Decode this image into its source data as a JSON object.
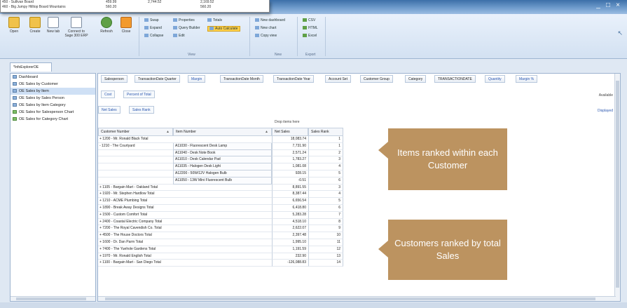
{
  "overlay": {
    "rows": [
      {
        "label": "450 - Sullivan Board",
        "v1": "459.99",
        "v2": "2,744.52",
        "v3": "2,169.52"
      },
      {
        "label": "460 - Big Jumpy Hilltop Board Mountains",
        "v1": "560.20",
        "v2": "",
        "v3": "560.20"
      }
    ]
  },
  "window": {
    "controls": [
      "_",
      "□",
      "×"
    ]
  },
  "ribbon": {
    "buttons": [
      "Open",
      "Create",
      "New tab",
      "Connect to Sage 300 ERP",
      "Refresh",
      "Close"
    ],
    "view_items": [
      {
        "label": "Swap",
        "hl": false
      },
      {
        "label": "Expand",
        "hl": false
      },
      {
        "label": "Collapse",
        "hl": false
      },
      {
        "label": "Properties",
        "hl": false
      },
      {
        "label": "Query Builder",
        "hl": false
      },
      {
        "label": "Edit",
        "hl": false
      },
      {
        "label": "Totals",
        "hl": false
      },
      {
        "label": "Auto Calculate",
        "hl": true
      }
    ],
    "view_group": "View",
    "new_items": [
      "New dashboard",
      "New chart",
      "Copy view"
    ],
    "new_group": "New",
    "export_items": [
      "CSV",
      "HTML",
      "Excel"
    ],
    "export_group": "Export"
  },
  "doc_tab": "*InfoExplorerOE",
  "tree": [
    {
      "label": "Dashboard",
      "kind": "view",
      "selected": false
    },
    {
      "label": "OE Sales by Customer",
      "kind": "view",
      "selected": false
    },
    {
      "label": "OE Sales by Item",
      "kind": "view",
      "selected": true
    },
    {
      "label": "OE Sales by Sales Person",
      "kind": "view",
      "selected": false
    },
    {
      "label": "OE Sales by Item Category",
      "kind": "view",
      "selected": false
    },
    {
      "label": "OE Sales for Salesperson Chart",
      "kind": "chart",
      "selected": false
    },
    {
      "label": "OE Sales for Category Chart",
      "kind": "chart",
      "selected": false
    }
  ],
  "fields": [
    {
      "label": "Salesperson",
      "blue": false
    },
    {
      "label": "TransactionDate Quarter",
      "blue": false
    },
    {
      "label": "Margin",
      "blue": true
    },
    {
      "label": "TransactionDate Month",
      "blue": false
    },
    {
      "label": "TransactionDate Year",
      "blue": false
    },
    {
      "label": "Account Set",
      "blue": false
    },
    {
      "label": "Customer Group",
      "blue": false
    },
    {
      "label": "Category",
      "blue": false
    },
    {
      "label": "TRANSACTIONDATE",
      "blue": false
    },
    {
      "label": "Quantity",
      "blue": true
    },
    {
      "label": "Margin %",
      "blue": true
    }
  ],
  "measures_row1": [
    "Cost",
    "Percent of Total"
  ],
  "measures_row2": [
    "Net Sales",
    "Sales Rank"
  ],
  "available": "Available",
  "displayed": "Displayed",
  "drop_here": "Drop items here",
  "columns": {
    "customer": "Customer Number",
    "item": "Item Number",
    "net_sales": "Net Sales",
    "sales_rank": "Sales Rank"
  },
  "rows": [
    {
      "cust": "+ 1200 - Mr. Ronald Black Total",
      "item": "",
      "net": "18,083.74",
      "rank": "1",
      "boxed": false
    },
    {
      "cust": "- 1210 - The Courtyard",
      "item": "A11030 - Fluorescent Desk Lamp",
      "net": "7,731.90",
      "rank": "1",
      "boxed": true
    },
    {
      "cust": "",
      "item": "A11040 - Desk Note Book",
      "net": "2,571.24",
      "rank": "2",
      "boxed": true
    },
    {
      "cust": "",
      "item": "A11010 - Desk Calendar Pad",
      "net": "1,783.27",
      "rank": "3",
      "boxed": true
    },
    {
      "cust": "",
      "item": "A11035 - Halogen Desk Light",
      "net": "1,081.08",
      "rank": "4",
      "boxed": true
    },
    {
      "cust": "",
      "item": "A12200 - 50W/12V Halogen Bulb",
      "net": "928.15",
      "rank": "5",
      "boxed": true
    },
    {
      "cust": "",
      "item": "A11050 - 13W Mini Fluorescent Bulb",
      "net": "-0.51",
      "rank": "6",
      "boxed": true
    },
    {
      "cust": "+ 1105 - Bargain Mart - Oakland Total",
      "item": "",
      "net": "8,891.55",
      "rank": "3",
      "boxed": false
    },
    {
      "cust": "+ 1920 - Mr. Stephen Hardlow Total",
      "item": "",
      "net": "8,387.44",
      "rank": "4",
      "boxed": false
    },
    {
      "cust": "+ 1210 - ACME Plumbing Total",
      "item": "",
      "net": "6,656.54",
      "rank": "5",
      "boxed": false
    },
    {
      "cust": "+ 1890 - Break Away Designs Total",
      "item": "",
      "net": "6,418.80",
      "rank": "6",
      "boxed": false
    },
    {
      "cust": "+ 1500 - Custom Comfort Total",
      "item": "",
      "net": "5,283.28",
      "rank": "7",
      "boxed": false
    },
    {
      "cust": "+ 2400 - Coastal Electric Company Total",
      "item": "",
      "net": "4,518.10",
      "rank": "8",
      "boxed": false
    },
    {
      "cust": "+ 7200 - The Royal Cavendish Co. Total",
      "item": "",
      "net": "2,622.07",
      "rank": "9",
      "boxed": false
    },
    {
      "cust": "+ 4500 - The House Doctors Total",
      "item": "",
      "net": "2,397.48",
      "rank": "10",
      "boxed": false
    },
    {
      "cust": "+ 1600 - Dr. Dan Parm Total",
      "item": "",
      "net": "1,995.10",
      "rank": "11",
      "boxed": false
    },
    {
      "cust": "+ 7400 - The Yuehole Gardens Total",
      "item": "",
      "net": "1,191.59",
      "rank": "12",
      "boxed": false
    },
    {
      "cust": "+ 1970 - Mr. Ronald English Total",
      "item": "",
      "net": "232.90",
      "rank": "13",
      "boxed": false
    },
    {
      "cust": "+ 1100 - Bargain Mart - San Diego Total",
      "item": "",
      "net": "-126,088.83",
      "rank": "14",
      "boxed": false
    }
  ],
  "callouts": [
    {
      "text": "Items ranked within each Customer"
    },
    {
      "text": "Customers ranked by total Sales"
    }
  ],
  "colors": {
    "callout": "#bc9360",
    "highlight": "#ffd24a"
  }
}
